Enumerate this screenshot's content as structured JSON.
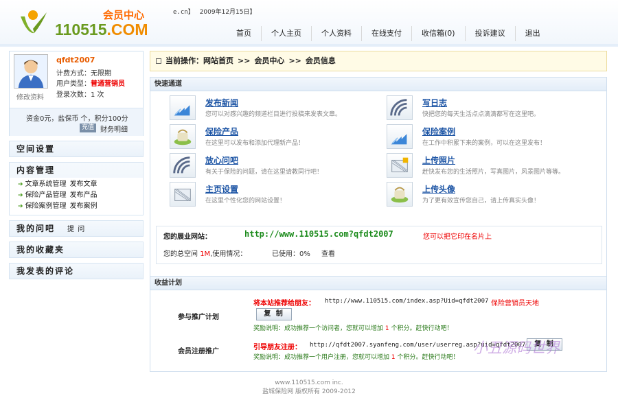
{
  "header": {
    "logo_title": "会员中心",
    "logo_domain_a": "110515",
    "logo_domain_b": ".COM",
    "top_prefix": "e.cn】",
    "top_date": "2009年12月15日】",
    "nav": [
      "首页",
      "个人主页",
      "个人资料",
      "在线支付",
      "收信箱(0)",
      "投诉建议",
      "退出"
    ]
  },
  "sidebar": {
    "username": "qfdt2007",
    "billing": "计费方式：无限期",
    "user_type_label": "用户类型：",
    "user_type": "普通营销员",
    "login_count": "登录次数：1 次",
    "edit_profile": "修改资料",
    "funds": "资金0元，盐保币 个，积分100分",
    "recharge": "充值",
    "finance": "财务明细",
    "sections": {
      "space": "空间设置",
      "content": "内容管理",
      "questions": "我的问吧",
      "questions_extra": "提 问",
      "favorites": "我的收藏夹",
      "comments": "我发表的评论"
    },
    "content_links": [
      {
        "a": "文章系统管理",
        "b": "发布文章"
      },
      {
        "a": "保险产品管理",
        "b": "发布产品"
      },
      {
        "a": "保险案例管理",
        "b": "发布案例"
      }
    ]
  },
  "main": {
    "crumb_label": "当前操作：",
    "crumb": [
      "网站首页",
      "会员中心",
      "会员信息"
    ],
    "crumb_sep": ">>",
    "quick_title": "快速通道",
    "quick": [
      {
        "title": "发布新闻",
        "desc": "您可以对感兴趣的频道栏目进行投稿来发表文章。"
      },
      {
        "title": "写日志",
        "desc": "快把您的每天生活点点滴滴都写在这里吧。"
      },
      {
        "title": "保险产品",
        "desc": "在这里可以发布和添加代理新产品！"
      },
      {
        "title": "保险案例",
        "desc": "在工作中积累下来的案例，可以在这里发布！"
      },
      {
        "title": "放心问吧",
        "desc": "有关于保险的问题，请在这里请教同行吧！"
      },
      {
        "title": "上传照片",
        "desc": "赶快发布您的生活照片，写真图片，风景图片等等。"
      },
      {
        "title": "主页设置",
        "desc": "在这里个性化您的网站设置！"
      },
      {
        "title": "上传头像",
        "desc": "为了更有效宣传您自己，请上传真实头像！"
      }
    ],
    "site_label": "您的展业网站：",
    "site_url": "http://www.110515.com?qfdt2007",
    "site_tip": "您可以把它印在名片上",
    "space_label": "您的总空间",
    "space_size": "1M",
    "space_usage": ",使用情况：",
    "used": "已使用：0%",
    "view": "查看"
  },
  "earn": {
    "title": "收益计划",
    "promo_label": "参与推广计划",
    "promo_title": "将本站推荐给朋友：",
    "promo_url": "http://www.110515.com/index.asp?Uid=qfdt2007",
    "promo_link": "保险营销员天地",
    "copy": "复 制",
    "reward1_a": "奖励说明：成功推荐一个访问者，您就可以增加",
    "reward1_n": "1",
    "reward1_b": "个积分。赶快行动吧！",
    "reg_label": "会员注册推广",
    "reg_title": "引导朋友注册：",
    "reg_url": "http://qfdt2007.syanfeng.com/user/userreg.asp?uid=qfdt2007",
    "reward2_a": "奖励说明：成功推荐一个用户注册，您就可以增加",
    "reward2_n": "1",
    "reward2_b": "个积分。赶快行动吧！",
    "watermark": "小丑源码世界"
  },
  "footer": {
    "line1": "www.110515.com inc.",
    "line2": "盐城保险网 版权所有 2009-2012"
  }
}
